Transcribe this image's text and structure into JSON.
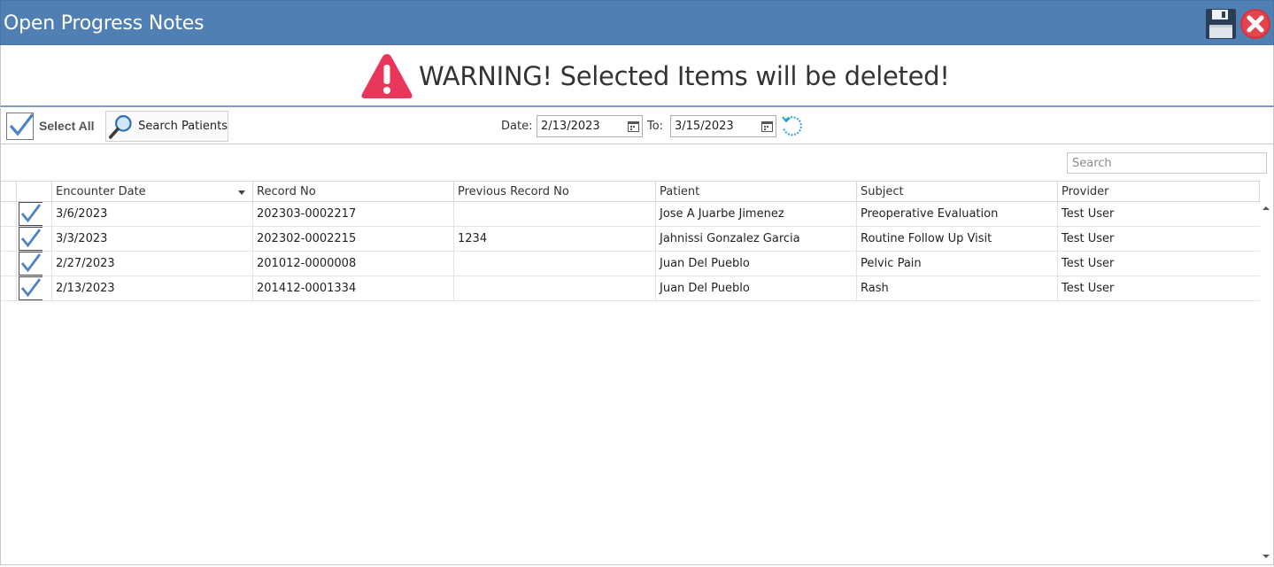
{
  "window": {
    "title": "Open Progress Notes",
    "save_icon": "floppy-disk-icon",
    "close_icon": "close-x-icon",
    "title_bar_color": "#5080b3"
  },
  "warning": {
    "text": "WARNING! Selected Items will be deleted!",
    "icon": "warning-triangle-icon",
    "icon_color": "#e8375a"
  },
  "toolbar": {
    "select_all_label": "Select All",
    "search_patients_label": "Search Patients",
    "date_label": "Date:",
    "date_from": "2/13/2023",
    "to_label": "To:",
    "date_to": "3/15/2023",
    "refresh_icon": "refresh-icon"
  },
  "grid": {
    "search_placeholder": "Search",
    "columns": [
      "Encounter Date",
      "Record No",
      "Previous Record No",
      "Patient",
      "Subject",
      "Provider"
    ],
    "sorted_column": "Encounter Date",
    "sort_direction": "descending",
    "rows": [
      {
        "checked": true,
        "encounter_date": "3/6/2023",
        "record_no": "202303-0002217",
        "previous_record_no": "",
        "patient": "Jose A Juarbe Jimenez",
        "subject": "Preoperative Evaluation",
        "provider": "Test User"
      },
      {
        "checked": true,
        "encounter_date": "3/3/2023",
        "record_no": "202302-0002215",
        "previous_record_no": "1234",
        "patient": "Jahnissi Gonzalez Garcia",
        "subject": "Routine Follow Up Visit",
        "provider": "Test User"
      },
      {
        "checked": true,
        "encounter_date": "2/27/2023",
        "record_no": "201012-0000008",
        "previous_record_no": "",
        "patient": "Juan Del Pueblo",
        "subject": "Pelvic Pain",
        "provider": "Test User"
      },
      {
        "checked": true,
        "encounter_date": "2/13/2023",
        "record_no": "201412-0001334",
        "previous_record_no": "",
        "patient": "Juan Del Pueblo",
        "subject": "Rash",
        "provider": "Test User"
      }
    ]
  }
}
